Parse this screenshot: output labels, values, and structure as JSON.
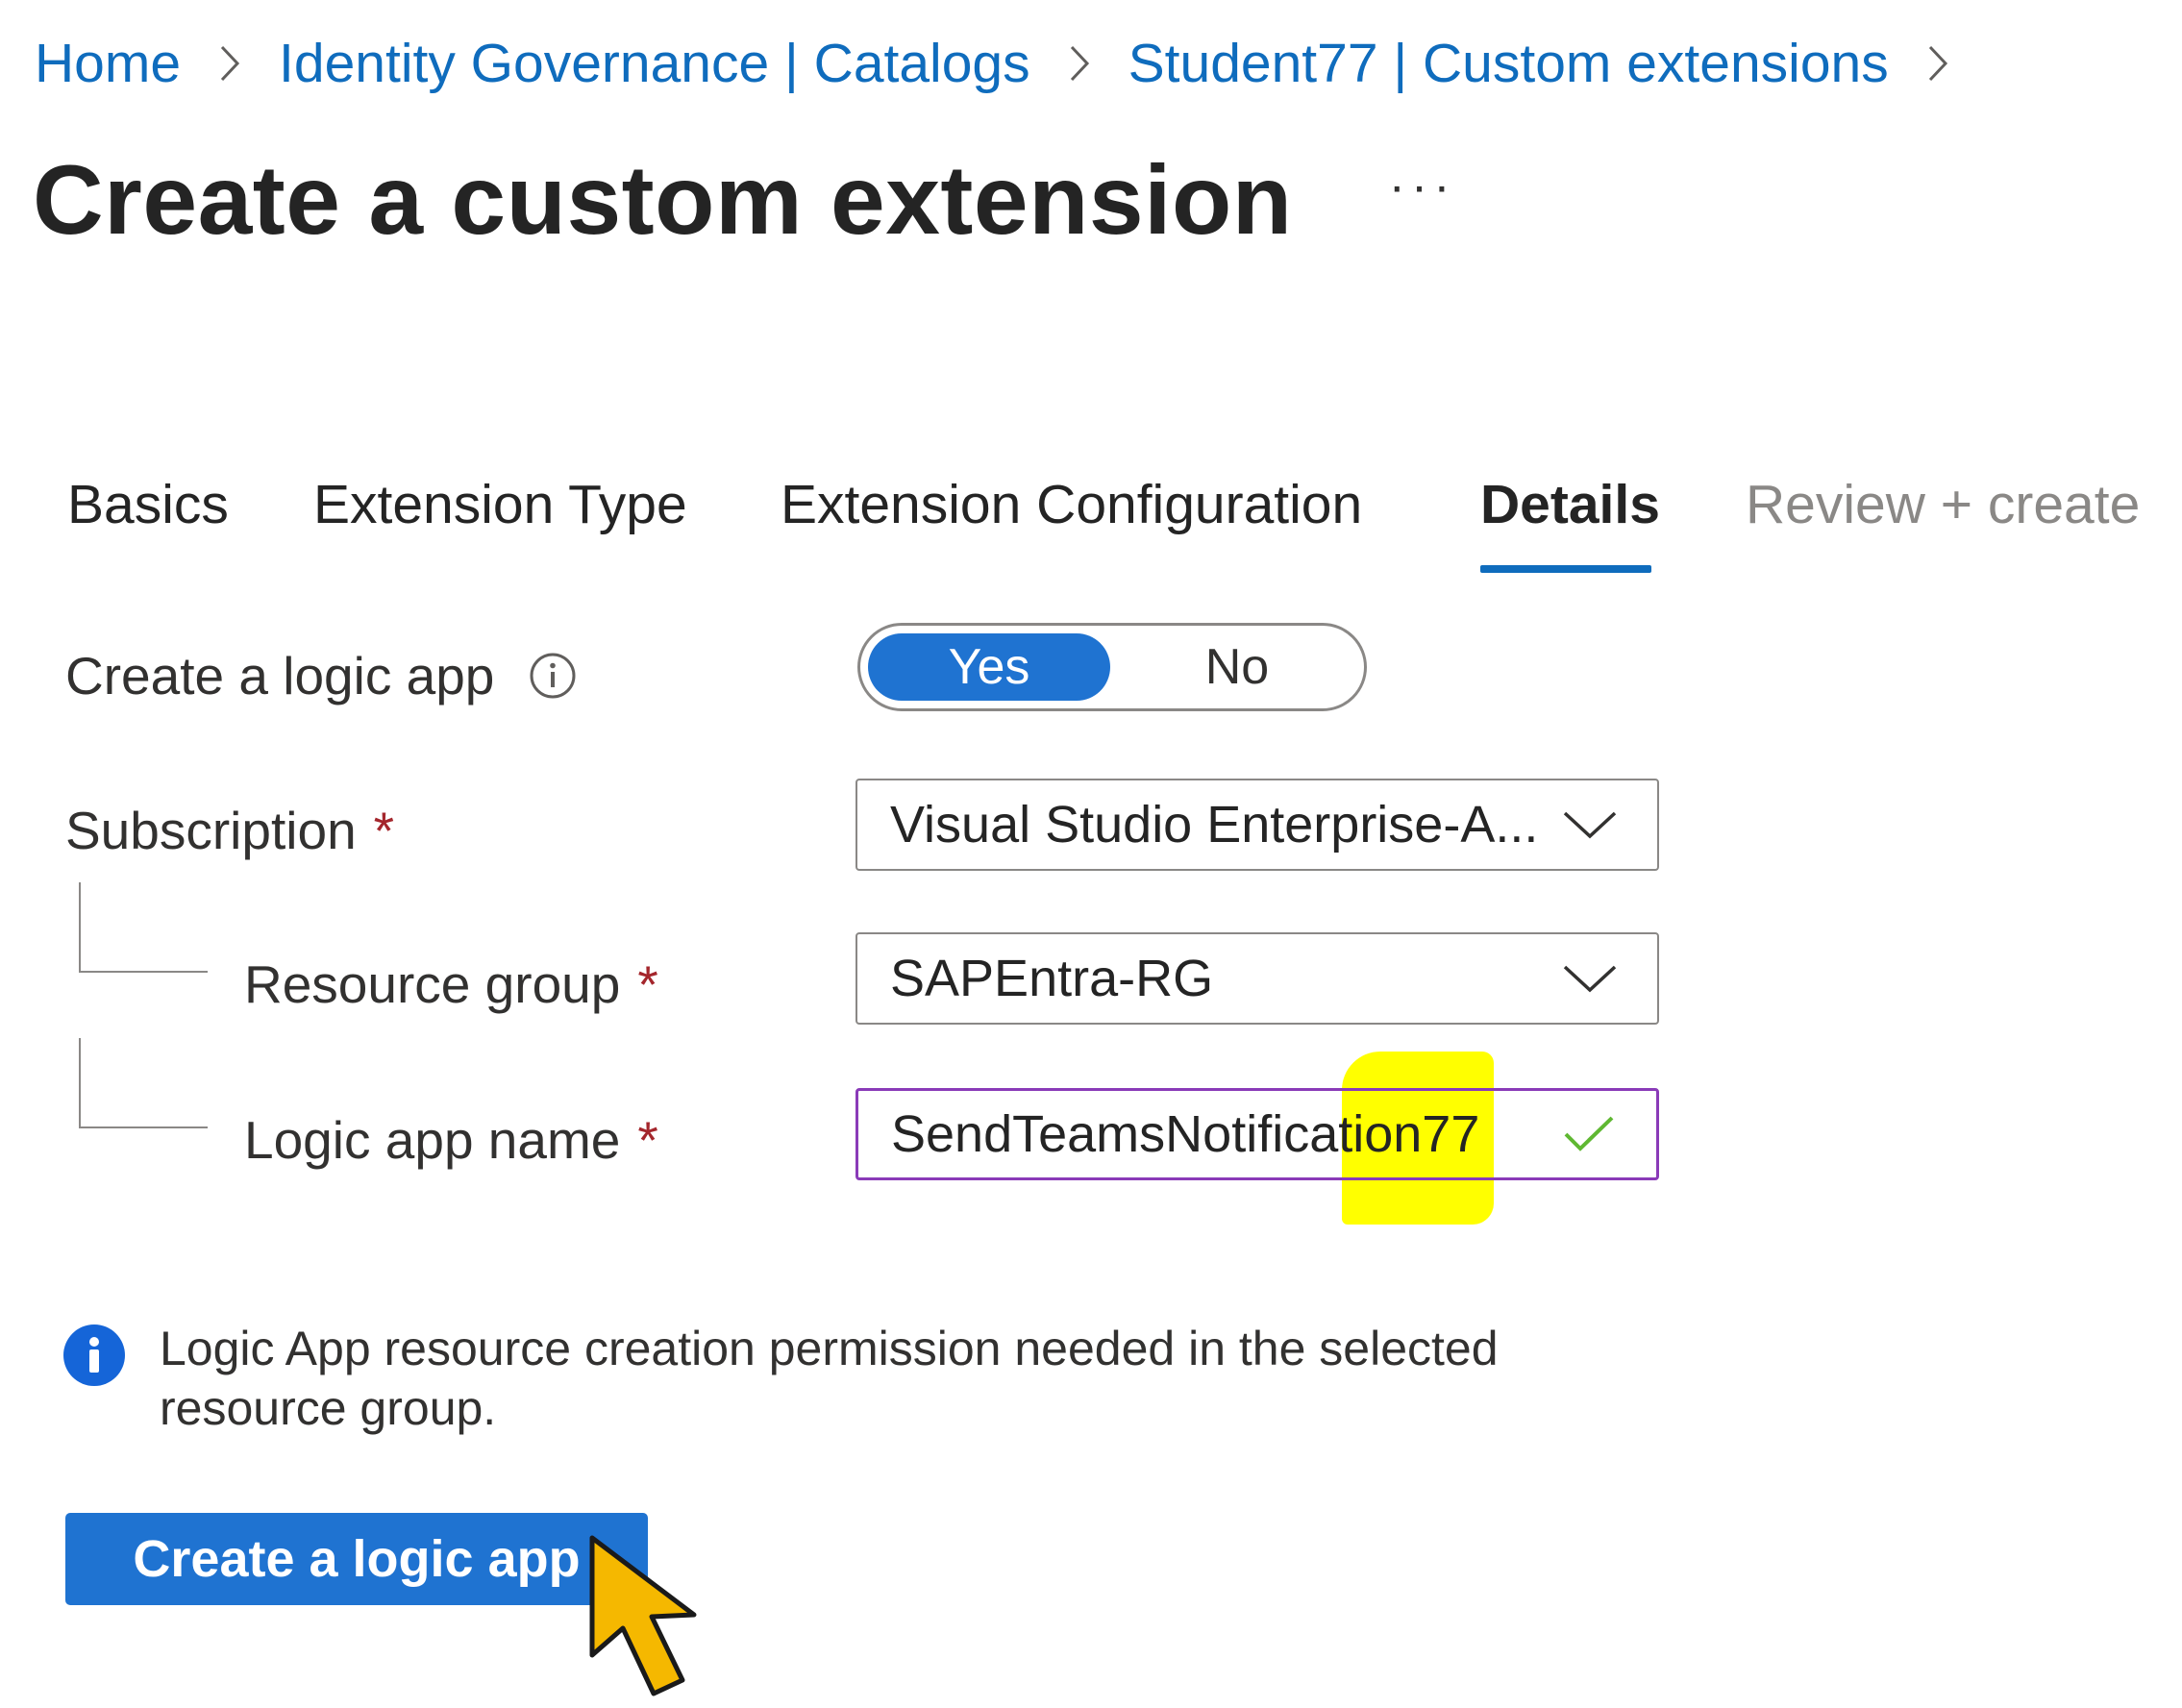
{
  "breadcrumb": {
    "items": [
      "Home",
      "Identity Governance | Catalogs",
      "Student77 | Custom extensions"
    ]
  },
  "page": {
    "title": "Create a custom extension",
    "more": "···"
  },
  "tabs": [
    {
      "label": "Basics",
      "state": "normal"
    },
    {
      "label": "Extension Type",
      "state": "normal"
    },
    {
      "label": "Extension Configuration",
      "state": "normal"
    },
    {
      "label": "Details",
      "state": "active"
    },
    {
      "label": "Review + create",
      "state": "disabled"
    }
  ],
  "form": {
    "create_logic_app": {
      "label": "Create a logic app",
      "options": [
        "Yes",
        "No"
      ],
      "selected": "Yes"
    },
    "subscription": {
      "label": "Subscription",
      "required": "*",
      "value": "Visual Studio Enterprise-A..."
    },
    "resource_group": {
      "label": "Resource group",
      "required": "*",
      "value": "SAPEntra-RG"
    },
    "logic_app_name": {
      "label": "Logic app name",
      "required": "*",
      "value": "SendTeamsNotification77"
    }
  },
  "info": {
    "message": "Logic App resource creation permission needed in the selected resource group."
  },
  "actions": {
    "create_logic_app_button": "Create a logic app"
  },
  "colors": {
    "link": "#0f6cbd",
    "accent": "#1f73d1",
    "required": "#a4262c",
    "valid_check": "#5fb832",
    "highlight": "#ffff00",
    "cursor": "#f5b800"
  }
}
